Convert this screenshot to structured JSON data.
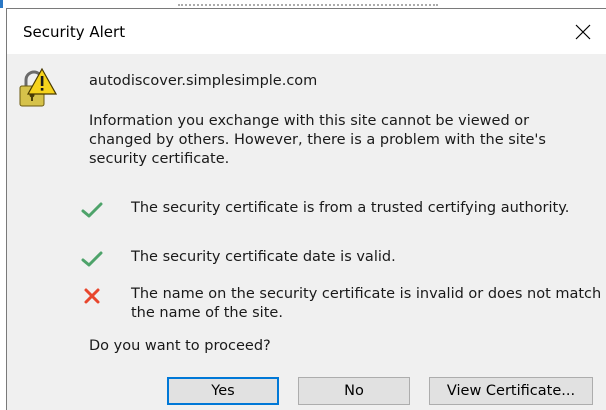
{
  "dialog": {
    "title": "Security Alert",
    "host": "autodiscover.simplesimple.com",
    "info": "Information you exchange with this site cannot be viewed or changed by others. However, there is a problem with the site's security certificate.",
    "checks": [
      {
        "status": "ok",
        "icon": "check-icon",
        "color": "#4ea36a",
        "text": "The security certificate is from a trusted certifying authority."
      },
      {
        "status": "ok",
        "icon": "check-icon",
        "color": "#4ea36a",
        "text": "The security certificate date is valid."
      },
      {
        "status": "error",
        "icon": "cross-icon",
        "color": "#e8462d",
        "text": "The name on the security certificate is invalid or does not match the name of the site."
      }
    ],
    "question": "Do you want to proceed?",
    "buttons": {
      "yes": "Yes",
      "no": "No",
      "view_certificate": "View Certificate..."
    }
  },
  "colors": {
    "dialog_bg": "#f0f0f0",
    "title_bg": "#ffffff",
    "default_button_border": "#0078d7",
    "button_bg": "#e1e1e1"
  },
  "icons": {
    "close": "close-icon",
    "warning": "lock-warning-icon"
  }
}
